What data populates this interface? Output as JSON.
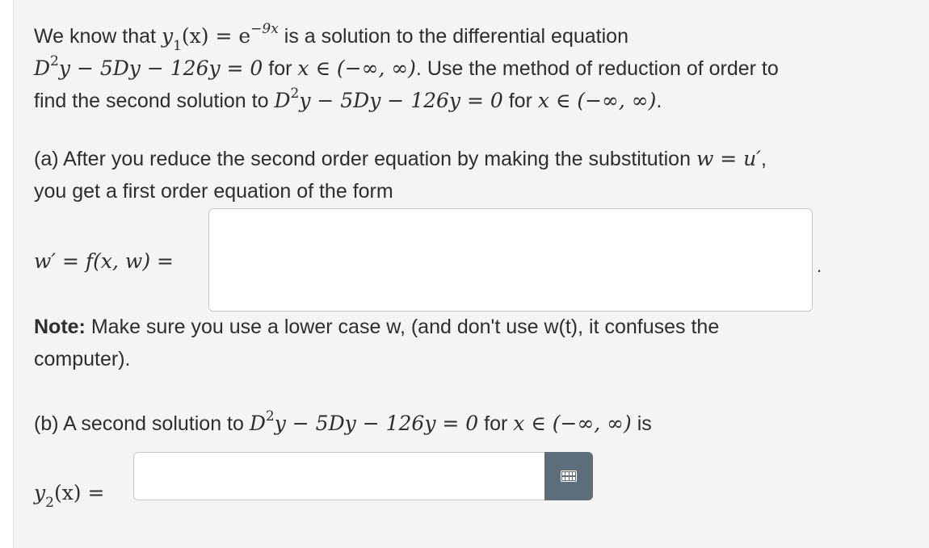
{
  "intro": {
    "line1": {
      "t1": "We know that ",
      "y1": "y",
      "sub1": "1",
      "x1": "(x) = e",
      "exp": "−9x",
      "t2": " is a solution to the differential equation"
    },
    "line2": {
      "eq": "D",
      "sq": "2",
      "eq2": "y − 5Dy − 126y = 0",
      "t1": " for ",
      "dom": "x ∈ (−∞, ∞)",
      "t2": ". Use the method of reduction of order to"
    },
    "line3": {
      "t1": "find the second solution to ",
      "eq": "D",
      "sq": "2",
      "eq2": "y − 5Dy − 126y = 0",
      "t2": " for ",
      "dom": "x ∈ (−∞, ∞)",
      "t3": "."
    }
  },
  "part_a": {
    "text1": "(a) After you reduce the second order equation by making the substitution ",
    "sub": "w = u′",
    "text1b": ",",
    "text2": "you get a first order equation of the form",
    "lhs": "w′ = f(x, w) =",
    "input_value": "",
    "period": "."
  },
  "note": {
    "bold": "Note:",
    "text1": " Make sure you use a lower case w, (and don't use w(t), it confuses the",
    "text2": "computer)."
  },
  "part_b": {
    "t1": "(b) A second solution to ",
    "eq": "D",
    "sq": "2",
    "eq2": "y − 5Dy − 126y = 0",
    "t2": " for ",
    "dom": "x ∈ (−∞, ∞)",
    "t3": " is",
    "lhs_y": "y",
    "lhs_sub": "2",
    "lhs_rest": "(x) =",
    "input_value": "",
    "keypad_icon": "keypad-icon"
  }
}
